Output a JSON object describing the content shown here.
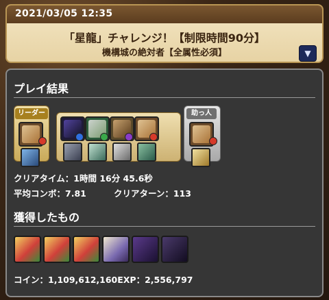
{
  "header": {
    "date": "2021/03/05 12:35",
    "title": "「星龍」チャレンジ！【制限時間90分】",
    "subtitle": "機構城の絶対者【全属性必須】",
    "dropdown_icon": "▼"
  },
  "result": {
    "section_title": "プレイ結果",
    "leader_label": "リーダー",
    "helper_label": "助っ人",
    "clear_time_label": "クリアタイム：",
    "clear_time_value": "1時間 16分 45.6秒",
    "avg_combo_label": "平均コンボ：",
    "avg_combo_value": "7.81",
    "clear_turn_label": "クリアターン：",
    "clear_turn_value": "113"
  },
  "rewards": {
    "section_title": "獲得したもの",
    "coin_label": "コイン：",
    "coin_value": "1,109,612,160",
    "exp_label": "EXP：",
    "exp_value": "2,556,797"
  },
  "colors": {
    "fire": "#d63a2a",
    "water": "#2f6fe0",
    "wood": "#3aa84a",
    "light": "#f0c93a",
    "dark": "#8a3cc8"
  }
}
